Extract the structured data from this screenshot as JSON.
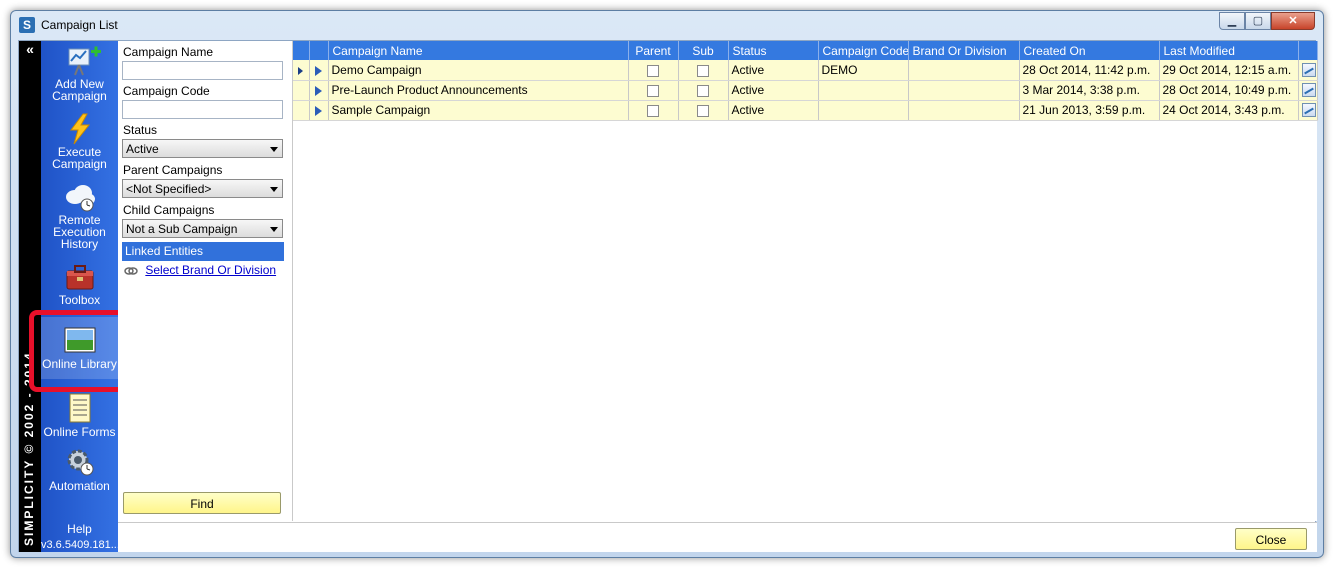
{
  "window": {
    "title": "Campaign List",
    "app_icon_letter": "S",
    "controls": {
      "minimize": "▁",
      "maximize": "▢",
      "close": "✕"
    }
  },
  "sidebar": {
    "collapse_glyph": "«",
    "brand": "SIMPLICITY © 2002 - 2014",
    "items": [
      {
        "label": "Add New Campaign",
        "icon": "add-campaign-icon"
      },
      {
        "label": "Execute Campaign",
        "icon": "lightning-icon"
      },
      {
        "label": "Remote Execution History",
        "icon": "cloud-clock-icon"
      },
      {
        "label": "Toolbox",
        "icon": "toolbox-icon"
      },
      {
        "label": "Online Library",
        "icon": "picture-icon",
        "active": true
      },
      {
        "label": "Online Forms",
        "icon": "form-icon"
      },
      {
        "label": "Automation",
        "icon": "gear-clock-icon"
      },
      {
        "label": "Help",
        "icon": "help-icon"
      }
    ],
    "version": "v3.6.5409.181..."
  },
  "filter": {
    "campaign_name_label": "Campaign Name",
    "campaign_name_value": "",
    "campaign_code_label": "Campaign Code",
    "campaign_code_value": "",
    "status_label": "Status",
    "status_value": "Active",
    "parent_label": "Parent Campaigns",
    "parent_value": "<Not Specified>",
    "child_label": "Child Campaigns",
    "child_value": "Not a Sub Campaign",
    "linked_header": "Linked Entities",
    "link_text": "Select Brand Or Division",
    "find_label": "Find"
  },
  "grid": {
    "columns": [
      "",
      "",
      "Campaign Name",
      "Parent",
      "Sub",
      "Status",
      "Campaign Code",
      "Brand Or Division",
      "Created On",
      "Last Modified",
      ""
    ],
    "rows": [
      {
        "name": "Demo Campaign",
        "parent": false,
        "sub": false,
        "status": "Active",
        "code": "DEMO",
        "brand": "",
        "created": "28 Oct 2014, 11:42 p.m.",
        "modified": "29 Oct 2014, 12:15 a.m.",
        "selected": true
      },
      {
        "name": "Pre-Launch Product Announcements",
        "parent": false,
        "sub": false,
        "status": "Active",
        "code": "",
        "brand": "",
        "created": "3 Mar 2014, 3:38 p.m.",
        "modified": "28 Oct 2014, 10:49 p.m.",
        "selected": false
      },
      {
        "name": "Sample Campaign",
        "parent": false,
        "sub": false,
        "status": "Active",
        "code": "",
        "brand": "",
        "created": "21 Jun 2013, 3:59 p.m.",
        "modified": "24 Oct 2014, 3:43 p.m.",
        "selected": false
      }
    ]
  },
  "footer": {
    "close_label": "Close"
  },
  "colors": {
    "accent": "#3479e0",
    "sidebar": "#1f53c7",
    "row": "#fdfcd1",
    "highlight": "#e8102a",
    "button": "#fff58a"
  }
}
